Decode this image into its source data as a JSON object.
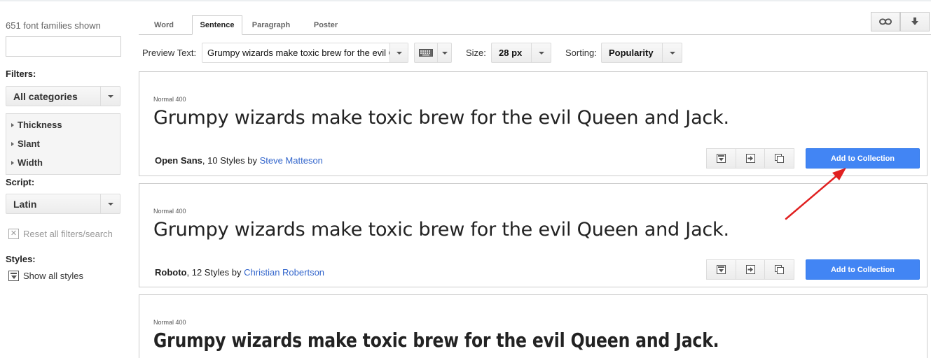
{
  "sidebar": {
    "families_count": "651 font families shown",
    "search_value": "",
    "filters_heading": "Filters:",
    "category_value": "All categories",
    "filter_items": [
      "Thickness",
      "Slant",
      "Width"
    ],
    "script_heading": "Script:",
    "script_value": "Latin",
    "reset_label": "Reset all filters/search",
    "styles_heading": "Styles:",
    "show_styles_label": "Show all styles"
  },
  "tabs": [
    {
      "label": "Word",
      "active": false
    },
    {
      "label": "Sentence",
      "active": true
    },
    {
      "label": "Paragraph",
      "active": false
    },
    {
      "label": "Poster",
      "active": false
    }
  ],
  "top_buttons": {
    "link_icon": "link-icon",
    "download_icon": "download-icon"
  },
  "toolbar": {
    "preview_label": "Preview Text:",
    "preview_value": "Grumpy wizards make toxic brew for the evil Queen and Jack.",
    "keyboard_icon": "keyboard-icon",
    "size_label": "Size:",
    "size_value": "28 px",
    "sorting_label": "Sorting:",
    "sorting_value": "Popularity"
  },
  "cards": [
    {
      "style_label": "Normal 400",
      "sample": "Grumpy wizards make toxic brew for the evil Queen and Jack.",
      "family": "Open Sans",
      "styles_text": ", 10 Styles by ",
      "author": "Steve Matteson",
      "add_label": "Add to Collection"
    },
    {
      "style_label": "Normal 400",
      "sample": "Grumpy wizards make toxic brew for the evil Queen and Jack.",
      "family": "Roboto",
      "styles_text": ", 12 Styles by ",
      "author": "Christian Robertson",
      "add_label": "Add to Collection"
    },
    {
      "style_label": "Normal 400",
      "sample": "Grumpy wizards make toxic brew for the evil Queen and Jack."
    }
  ],
  "colors": {
    "accent_blue": "#4285f4",
    "link_blue": "#3366cc",
    "annotation_arrow": "#e02020"
  }
}
